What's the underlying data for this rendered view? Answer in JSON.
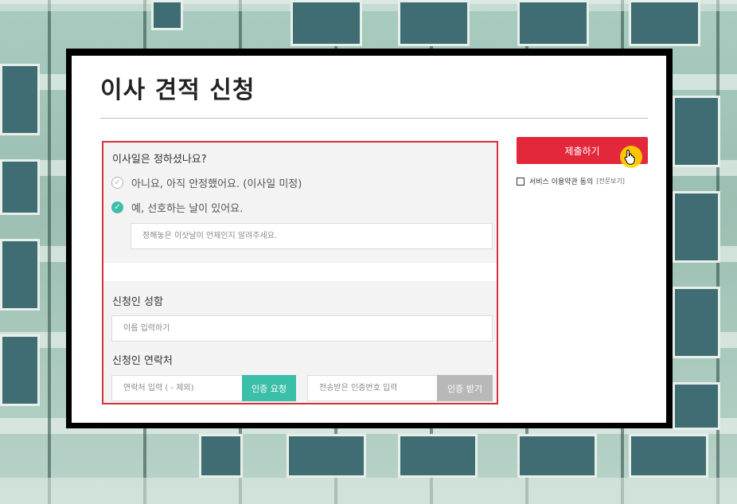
{
  "form": {
    "title": "이사 견적 신청",
    "move_date": {
      "question": "이사일은 정하셨나요?",
      "option_no": "아니요, 아직 안정했어요. (이사일 미정)",
      "option_yes": "예, 선호하는 날이 있어요.",
      "date_placeholder": "정해놓은 이삿날이 언제인지 알려주세요.",
      "selected": "yes"
    },
    "name": {
      "label": "신청인 성함",
      "placeholder": "이름 입력하기"
    },
    "phone": {
      "label": "신청인 연락처",
      "placeholder": "연락처 입력 ( - 제외)",
      "request_button": "인증 요청",
      "code_placeholder": "전송받은 인증번호 입력",
      "receive_button": "인증 받기"
    }
  },
  "sidebar": {
    "submit_label": "제출하기",
    "terms_label": "서비스 이용약관 동의",
    "terms_link": "[전문보기]"
  },
  "icons": {
    "unchecked": "circle-check-outline-icon",
    "checked": "circle-check-filled-icon",
    "cursor": "hand-pointer-icon"
  },
  "colors": {
    "accent_red": "#e3283c",
    "accent_green": "#3cbfa8",
    "highlight_border": "#d6303a"
  }
}
